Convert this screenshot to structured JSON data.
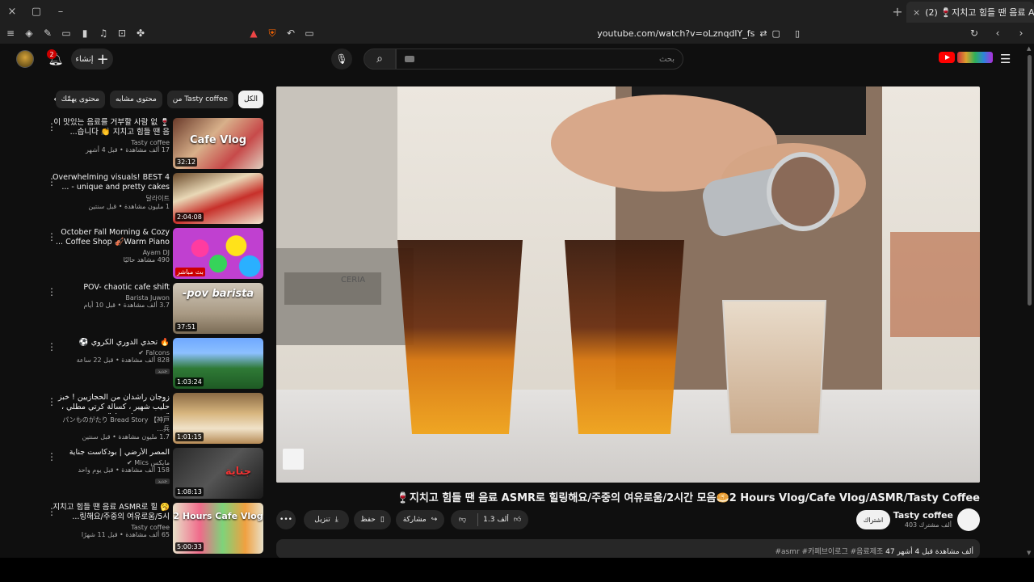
{
  "browser": {
    "window_controls": [
      "×",
      "▢",
      "–"
    ],
    "tab_title": "(2) 🍷지치고 힘들 땐 음료 AS...",
    "new_tab": "+",
    "tab_close": "×",
    "address": "youtube.com/watch?v=oLznqdlY_fs"
  },
  "header": {
    "notifications_count": "2",
    "create_label": "إنشاء",
    "search_placeholder": "بحث"
  },
  "chips": [
    {
      "label": "الكل"
    },
    {
      "label": "من Tasty coffee"
    },
    {
      "label": "محتوى مشابه"
    },
    {
      "label": "محتوى يهمّك"
    }
  ],
  "related": [
    {
      "title": "🍷 이 맛있는 음료를 거부할 사람 없습니다 👏 지치고 힘들 땐 음...",
      "channel": "Tasty coffee",
      "stats": "17 ألف مشاهدة • قبل 4 أشهر",
      "duration": "32:12",
      "overlay": "Cafe Vlog"
    },
    {
      "title": "Overwhelming visuals! BEST 4 unique and pretty cakes - ...",
      "channel": "달라이트",
      "stats": "1 مليون مشاهدة • قبل سنتين",
      "duration": "2:04:08",
      "overlay": ""
    },
    {
      "title": "October Fall Morning & Cozy Coffee Shop 🎻Warm Piano ...",
      "channel": "Ayam DJ",
      "stats": "490 مشاهد حاليًا",
      "duration": "بث مباشر",
      "overlay": ""
    },
    {
      "title": "POV- chaotic cafe shift",
      "channel": "Barista Juwon",
      "stats": "3.7 ألف مشاهدة • قبل 10 أيام",
      "duration": "37:51",
      "overlay": "-pov barista"
    },
    {
      "title": "🔥 تحدي الدوري الكروي ⚽",
      "channel": "Falcons",
      "stats": "828 ألف مشاهدة • قبل 22 ساعة",
      "duration": "1:03:24",
      "overlay": "",
      "badge": "جديد"
    },
    {
      "title": "زوجان راشدان من الحجازيين ! خبز حليب شهير ، كسالة كرتي مطلي ، \"يوم في حياة خباز\"",
      "channel": "パンものがたり Bread Story 【神戸 兵...",
      "stats": "1.7 مليون مشاهدة • قبل سنتين",
      "duration": "1:01:15",
      "overlay": ""
    },
    {
      "title": "المصر الأرضي | بودكاست جناية",
      "channel": "مايكس Mics",
      "stats": "158 ألف مشاهدة • قبل يوم واحد",
      "duration": "1:08:13",
      "overlay": "جناية",
      "badge": "جديد"
    },
    {
      "title": "🥱 지치고 힘들 땐 음료 ASMR로 힐링해요/주중의 여유로움/5시...",
      "channel": "Tasty coffee",
      "stats": "65 ألف مشاهدة • قبل 11 شهرًا",
      "duration": "5:00:33",
      "overlay": "2 Hours Cafe Vlog"
    }
  ],
  "video": {
    "title": "🍷지치고 힘들 땐 음료 ASMR로 힐링해요/주중의 여유로움/2시간 모음🥯2 Hours Vlog/Cafe Vlog/ASMR/Tasty Coffee",
    "channel": "Tasty coffee",
    "subscribers": "403 ألف مشترك",
    "subscribe_label": "اشتراك",
    "likes": "1.3 ألف",
    "share_label": "مشاركة",
    "save_label": "حفظ",
    "download_label": "تنزيل",
    "more_label": "•••",
    "views_date": "47 ألف مشاهدة قبل 4 أشهر",
    "hashtags": "#asmr #카페브이로그 #음료제조",
    "player_text": "CERIA"
  }
}
